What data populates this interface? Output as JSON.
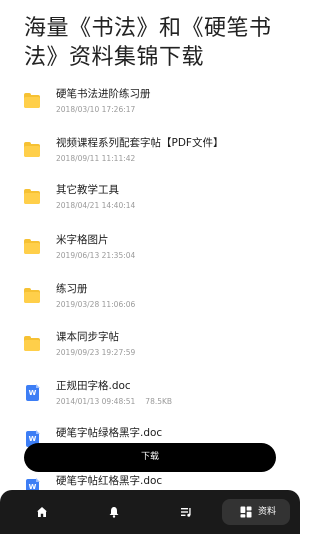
{
  "page": {
    "title": "海量《书法》和《硬笔书法》资料集锦下载"
  },
  "files": [
    {
      "type": "folder",
      "icon": "folder-icon",
      "name": "硬笔书法进阶练习册",
      "date": "2018/03/10 17:26:17",
      "size": ""
    },
    {
      "type": "folder",
      "icon": "folder-icon",
      "name": "视频课程系列配套字帖【PDF文件】",
      "date": "2018/09/11 11:11:42",
      "size": ""
    },
    {
      "type": "folder",
      "icon": "folder-icon",
      "name": "其它教学工具",
      "date": "2018/04/21 14:40:14",
      "size": ""
    },
    {
      "type": "folder",
      "icon": "folder-icon",
      "name": "米字格图片",
      "date": "2019/06/13 21:35:04",
      "size": ""
    },
    {
      "type": "folder",
      "icon": "folder-icon",
      "name": "练习册",
      "date": "2019/03/28 11:06:06",
      "size": ""
    },
    {
      "type": "folder",
      "icon": "folder-icon",
      "name": "课本同步字帖",
      "date": "2019/09/23 19:27:59",
      "size": ""
    },
    {
      "type": "doc",
      "icon": "word-doc-icon",
      "icon_letter": "W",
      "name": "正规田字格.doc",
      "date": "2014/01/13 09:48:51",
      "size": "78.5KB"
    },
    {
      "type": "doc",
      "icon": "word-doc-icon",
      "icon_letter": "W",
      "name": "硬笔字帖绿格黑字.doc",
      "date": "",
      "size": ""
    },
    {
      "type": "doc",
      "icon": "word-doc-icon",
      "icon_letter": "W",
      "name": "硬笔字帖红格黑字.doc",
      "date": "",
      "size": ""
    }
  ],
  "actions": {
    "download_label": "下载"
  },
  "tabbar": {
    "items": [
      {
        "icon": "home-icon",
        "label": "",
        "active": false
      },
      {
        "icon": "bell-icon",
        "label": "",
        "active": false
      },
      {
        "icon": "playlist-icon",
        "label": "",
        "active": false
      },
      {
        "icon": "grid-icon",
        "label": "资料",
        "active": true
      }
    ]
  },
  "colors": {
    "folder": "#ffcf4a",
    "doc": "#3d7ef5",
    "button_bg": "#000000",
    "tabbar_bg": "#1a1a1a",
    "tab_active_bg": "#333333"
  }
}
